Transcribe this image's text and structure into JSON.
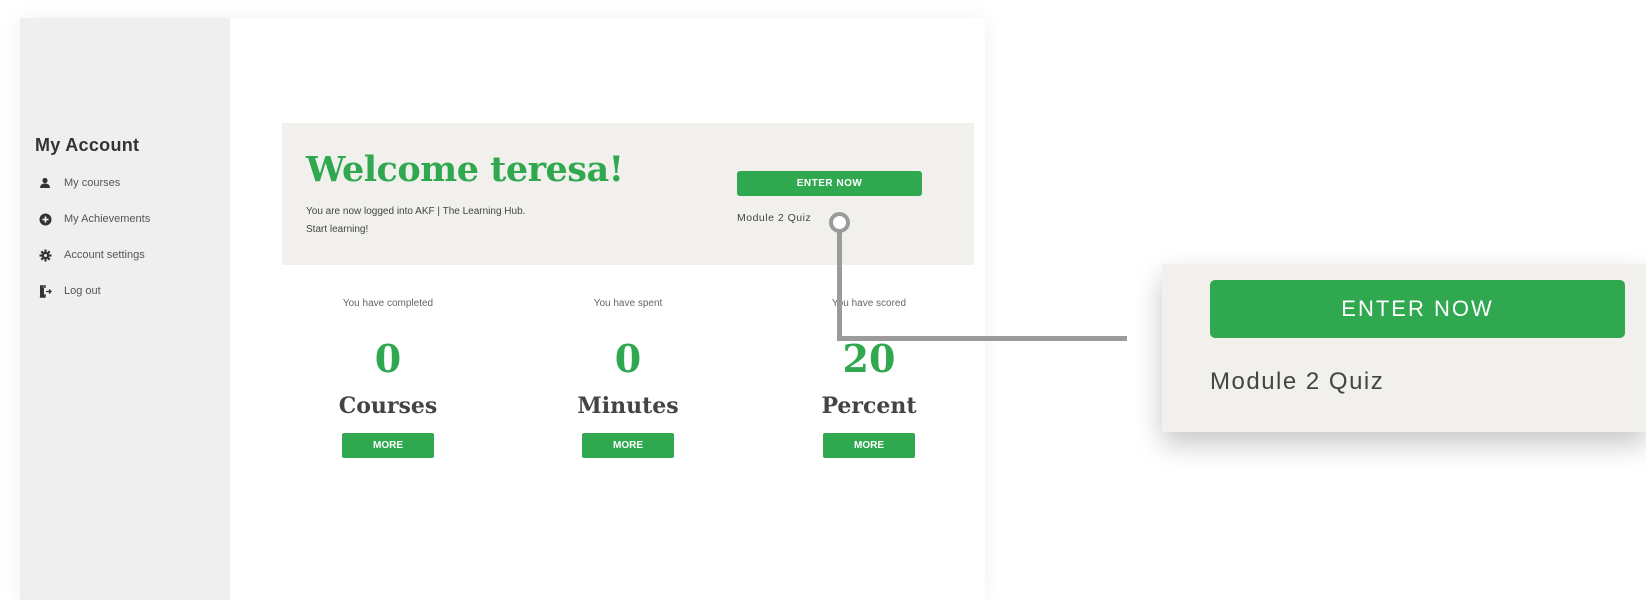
{
  "sidebar": {
    "title": "My Account",
    "items": [
      {
        "label": "My courses",
        "icon": "user-icon"
      },
      {
        "label": "My Achievements",
        "icon": "achievement-icon"
      },
      {
        "label": "Account settings",
        "icon": "gear-icon"
      },
      {
        "label": "Log out",
        "icon": "logout-icon"
      }
    ]
  },
  "banner": {
    "title": "Welcome teresa!",
    "text_line1": "You are now logged into AKF | The Learning Hub.",
    "text_line2": "Start learning!",
    "enter_label": "ENTER NOW",
    "quiz_label": "Module 2 Quiz"
  },
  "stats": [
    {
      "label": "You have completed",
      "value": "0",
      "unit": "Courses",
      "button": "MORE"
    },
    {
      "label": "You have spent",
      "value": "0",
      "unit": "Minutes",
      "button": "MORE"
    },
    {
      "label": "You have scored",
      "value": "20",
      "unit": "Percent",
      "button": "MORE"
    }
  ],
  "callout": {
    "enter_label": "ENTER NOW",
    "quiz_label": "Module 2 Quiz"
  },
  "colors": {
    "accent": "#2fa84f",
    "sidebar_bg": "#efefef",
    "banner_bg": "#f1f0ec",
    "connector": "#9b9b9b"
  }
}
